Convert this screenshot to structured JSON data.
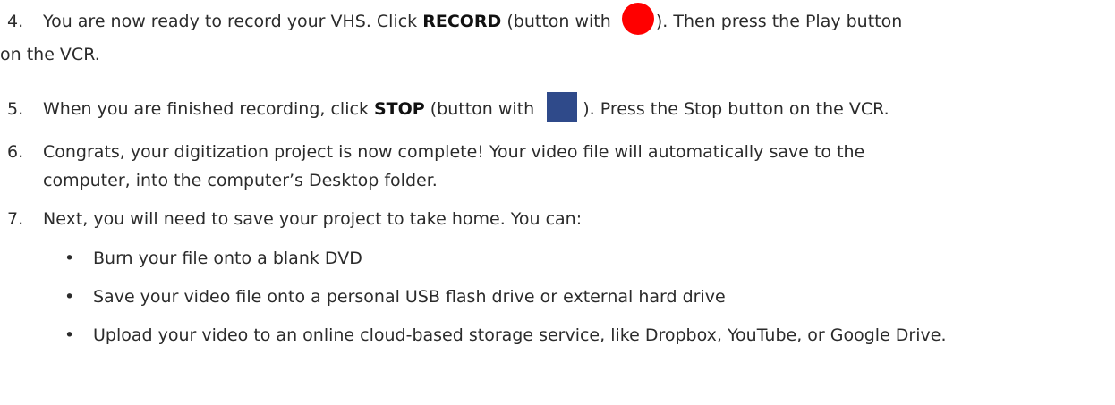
{
  "colors": {
    "record_dot": "#ff0000",
    "stop_square": "#2f4a8a",
    "text": "#2b2b2b"
  },
  "steps": [
    {
      "number": "4.",
      "pre": "You are now ready to record your VHS. Click ",
      "keyword": "RECORD",
      "mid": " (button with ",
      "post": "). Then press the Play button",
      "continuation": "on the VCR."
    },
    {
      "number": "5.",
      "pre": "When you are finished recording, click ",
      "keyword": "STOP",
      "mid": " (button with ",
      "post": "). Press the Stop button on the VCR."
    },
    {
      "number": "6.",
      "line1": "Congrats, your digitization project is now complete! Your video file will automatically save to the",
      "line2": "computer, into the computer’s Desktop folder."
    },
    {
      "number": "7.",
      "text": "Next, you will need to save your project to take home. You can:"
    }
  ],
  "bullets": [
    "Burn your file onto a blank DVD",
    "Save your video file onto a personal USB flash drive or external hard drive",
    "Upload your video to an online cloud-based storage service, like Dropbox, YouTube, or Google Drive."
  ],
  "bullet_symbol": "•"
}
